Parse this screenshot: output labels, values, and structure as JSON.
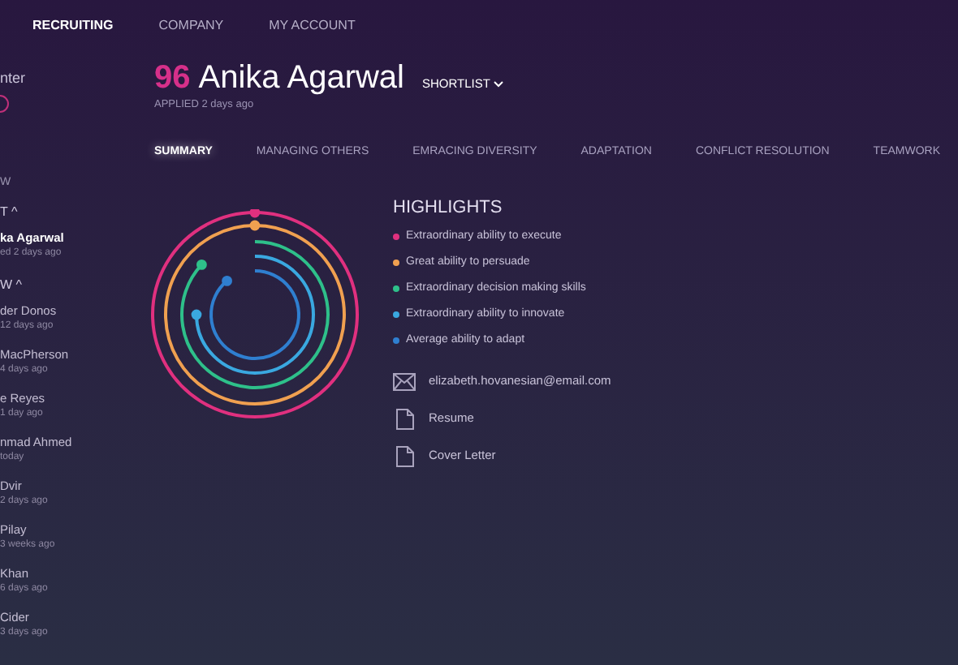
{
  "nav": [
    {
      "label": "RECRUITING",
      "selected": true
    },
    {
      "label": "COMPANY",
      "selected": false
    },
    {
      "label": "MY ACCOUNT",
      "selected": false
    }
  ],
  "sidebar": {
    "title": "nter",
    "section_label": "W",
    "groups": [
      {
        "label": "T ^",
        "items": [
          {
            "name": "ka Agarwal",
            "meta": "ed 2 days ago",
            "selected": true
          }
        ]
      },
      {
        "label": "W ^",
        "items": [
          {
            "name": "der Donos",
            "meta": "12 days ago",
            "selected": false
          },
          {
            "name": "MacPherson",
            "meta": "4 days ago",
            "selected": false
          },
          {
            "name": "e Reyes",
            "meta": "1 day ago",
            "selected": false
          },
          {
            "name": "nmad Ahmed",
            "meta": "today",
            "selected": false
          },
          {
            "name": "Dvir",
            "meta": "2 days ago",
            "selected": false
          },
          {
            "name": "Pilay",
            "meta": "3 weeks ago",
            "selected": false
          },
          {
            "name": "Khan",
            "meta": "6 days ago",
            "selected": false
          },
          {
            "name": "Cider",
            "meta": "3 days ago",
            "selected": false
          }
        ]
      }
    ]
  },
  "candidate": {
    "score": "96",
    "name": "Anika Agarwal",
    "status": "SHORTLIST",
    "applied": "APPLIED 2 days ago"
  },
  "tabs": [
    {
      "label": "SUMMARY",
      "selected": true
    },
    {
      "label": "MANAGING OTHERS",
      "selected": false
    },
    {
      "label": "EMRACING DIVERSITY",
      "selected": false
    },
    {
      "label": "ADAPTATION",
      "selected": false
    },
    {
      "label": "CONFLICT RESOLUTION",
      "selected": false
    },
    {
      "label": "TEAMWORK",
      "selected": false
    }
  ],
  "highlights": {
    "title": "HIGHLIGHTS",
    "items": [
      {
        "text": "Extraordinary ability to execute",
        "color": "#e0307f"
      },
      {
        "text": "Great ability to persuade",
        "color": "#f0a050"
      },
      {
        "text": "Extraordinary decision making skills",
        "color": "#2ec08a"
      },
      {
        "text": "Extraordinary ability to innovate",
        "color": "#3aa8e0"
      },
      {
        "text": "Average ability to adapt",
        "color": "#2f7fd0"
      }
    ]
  },
  "contact": [
    {
      "kind": "email",
      "text": "elizabeth.hovanesian@email.com"
    },
    {
      "kind": "document",
      "text": "Resume"
    },
    {
      "kind": "document",
      "text": "Cover Letter"
    }
  ]
}
